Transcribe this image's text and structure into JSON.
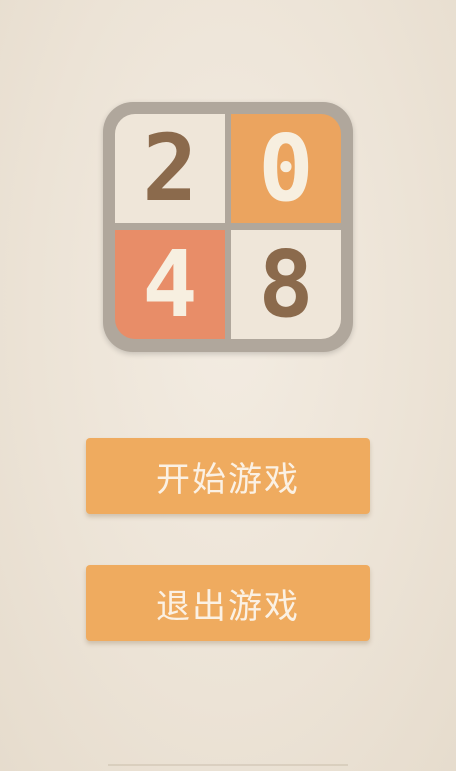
{
  "logo": {
    "frame_color": "#b0a79c",
    "tiles": [
      {
        "label": "2",
        "bg": "#efe6d9",
        "fg": "#8b6a4c"
      },
      {
        "label": "0",
        "bg": "#eba45f",
        "fg": "#f7efe0"
      },
      {
        "label": "4",
        "bg": "#e88d68",
        "fg": "#f7efe0"
      },
      {
        "label": "8",
        "bg": "#efe6d9",
        "fg": "#8b6a4c"
      }
    ]
  },
  "menu": {
    "start_label": "开始游戏",
    "quit_label": "退出游戏",
    "button_color": "#efab5f",
    "button_text_color": "#fbf1e4"
  },
  "colors": {
    "background": "#efe6da"
  }
}
